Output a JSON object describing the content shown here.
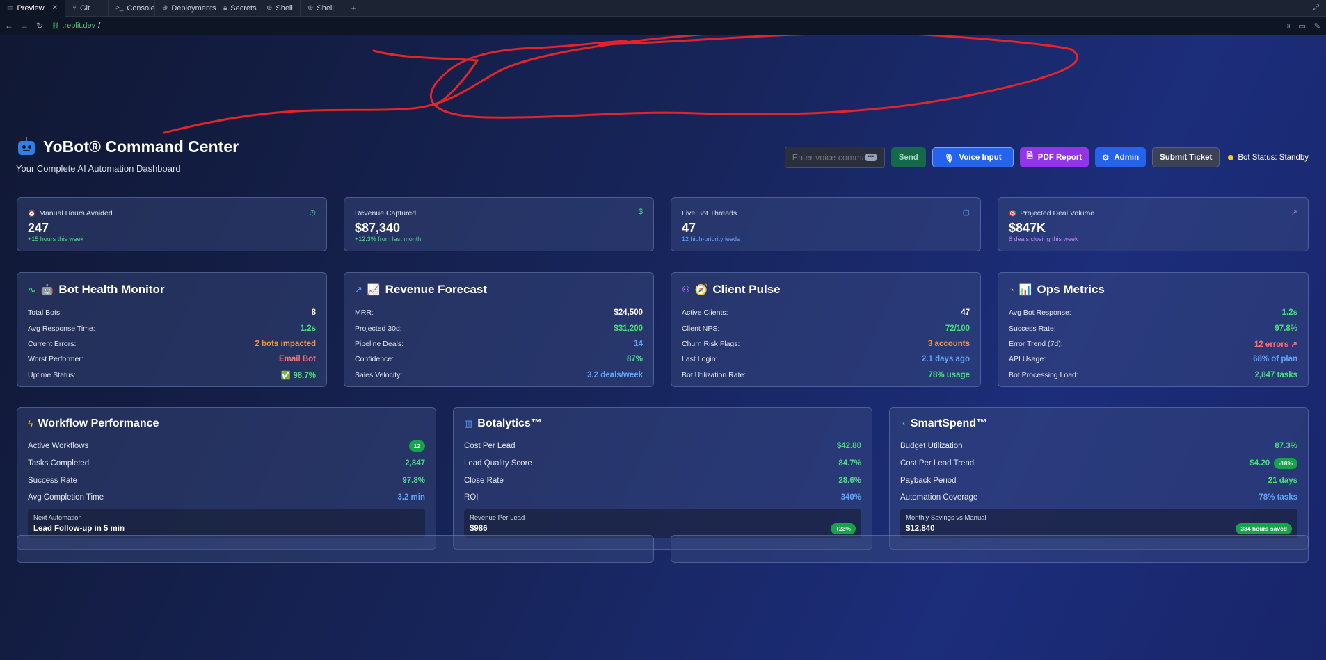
{
  "browser": {
    "tabs": [
      {
        "label": "Preview",
        "icon": "monitor-icon"
      },
      {
        "label": "Git",
        "icon": "git-icon"
      },
      {
        "label": "Console",
        "icon": "terminal-icon"
      },
      {
        "label": "Deployments",
        "icon": "deploy-icon"
      },
      {
        "label": "Secrets",
        "icon": "lock-icon"
      },
      {
        "label": "Shell",
        "icon": "shell-icon"
      },
      {
        "label": "Shell",
        "icon": "shell-icon"
      }
    ],
    "url_domain": ".replit.dev",
    "url_path": "/"
  },
  "header": {
    "title": "YoBot® Command Center",
    "subtitle": "Your Complete AI Automation Dashboard"
  },
  "controls": {
    "voice_placeholder": "Enter voice command...",
    "send_label": "Send",
    "voice_label": "Voice Input",
    "pdf_label": "PDF Report",
    "admin_label": "Admin",
    "ticket_label": "Submit Ticket",
    "bot_status": "Bot Status: Standby"
  },
  "kpis": [
    {
      "label": "Manual Hours Avoided",
      "emoji": "⏰",
      "value": "247",
      "delta": "+15 hours this week",
      "icon": "clock-icon",
      "color": "#4ade80"
    },
    {
      "label": "Revenue Captured",
      "emoji": "",
      "value": "$87,340",
      "delta": "+12.3% from last month",
      "icon": "dollar-icon",
      "color": "#4ade80"
    },
    {
      "label": "Live Bot Threads",
      "emoji": "",
      "value": "47",
      "delta": "12 high-priority leads",
      "icon": "chat-icon",
      "color": "#60a5fa"
    },
    {
      "label": "Projected Deal Volume",
      "emoji": "🎯",
      "value": "$847K",
      "delta": "6 deals closing this week",
      "icon": "trend-up-icon",
      "color": "#c084fc"
    }
  ],
  "metric_cards": [
    {
      "title": "Bot Health Monitor",
      "emoji": "🤖",
      "icon": "activity-icon",
      "rows": [
        {
          "label": "Total Bots:",
          "value": "8"
        },
        {
          "label": "Avg Response Time:",
          "value": "1.2s"
        },
        {
          "label": "Current Errors:",
          "value": "2 bots impacted"
        },
        {
          "label": "Worst Performer:",
          "value": "Email Bot"
        },
        {
          "label": "Uptime Status:",
          "value": "✅ 98.7%"
        }
      ]
    },
    {
      "title": "Revenue Forecast",
      "emoji": "📈",
      "icon": "trend-up-icon",
      "rows": [
        {
          "label": "MRR:",
          "value": "$24,500"
        },
        {
          "label": "Projected 30d:",
          "value": "$31,200"
        },
        {
          "label": "Pipeline Deals:",
          "value": "14"
        },
        {
          "label": "Confidence:",
          "value": "87%"
        },
        {
          "label": "Sales Velocity:",
          "value": "3.2 deals/week"
        }
      ]
    },
    {
      "title": "Client Pulse",
      "emoji": "🧭",
      "icon": "users-icon",
      "rows": [
        {
          "label": "Active Clients:",
          "value": "47"
        },
        {
          "label": "Client NPS:",
          "value": "72/100"
        },
        {
          "label": "Churn Risk Flags:",
          "value": "3 accounts"
        },
        {
          "label": "Last Login:",
          "value": "2.1 days ago"
        },
        {
          "label": "Bot Utilization Rate:",
          "value": "78% usage"
        }
      ]
    },
    {
      "title": "Ops Metrics",
      "emoji": "📊",
      "icon": "gauge-icon",
      "rows": [
        {
          "label": "Avg Bot Response:",
          "value": "1.2s"
        },
        {
          "label": "Success Rate:",
          "value": "97.8%"
        },
        {
          "label": "Error Trend (7d):",
          "value": "12 errors ↗"
        },
        {
          "label": "API Usage:",
          "value": "68% of plan"
        },
        {
          "label": "Bot Processing Load:",
          "value": "2,847 tasks"
        }
      ]
    }
  ],
  "wide_cards": [
    {
      "title": "Workflow Performance",
      "icon": "lightning-icon",
      "rows": [
        {
          "label": "Active Workflows",
          "value": "",
          "pill": "12"
        },
        {
          "label": "Tasks Completed",
          "value": "2,847",
          "pill": ""
        },
        {
          "label": "Success Rate",
          "value": "97.8%",
          "pill": ""
        },
        {
          "label": "Avg Completion Time",
          "value": "3.2 min",
          "pill": ""
        }
      ],
      "box": {
        "label": "Next Automation",
        "value": "Lead Follow-up in 5 min",
        "pill": ""
      }
    },
    {
      "title": "Botalytics™",
      "icon": "bar-chart-icon",
      "rows": [
        {
          "label": "Cost Per Lead",
          "value": "$42.80",
          "pill": ""
        },
        {
          "label": "Lead Quality Score",
          "value": "84.7%",
          "pill": ""
        },
        {
          "label": "Close Rate",
          "value": "28.6%",
          "pill": ""
        },
        {
          "label": "ROI",
          "value": "340%",
          "pill": ""
        }
      ],
      "box": {
        "label": "Revenue Per Lead",
        "value": "$986",
        "pill": "+23%"
      }
    },
    {
      "title": "SmartSpend™",
      "icon": "pie-chart-icon",
      "rows": [
        {
          "label": "Budget Utilization",
          "value": "87.3%",
          "pill": ""
        },
        {
          "label": "Cost Per Lead Trend",
          "value": "$4.20",
          "pill": "-18%"
        },
        {
          "label": "Payback Period",
          "value": "21 days",
          "pill": ""
        },
        {
          "label": "Automation Coverage",
          "value": "78% tasks",
          "pill": ""
        }
      ],
      "box": {
        "label": "Monthly Savings vs Manual",
        "value": "$12,840",
        "pill": "384 hours saved"
      }
    }
  ]
}
